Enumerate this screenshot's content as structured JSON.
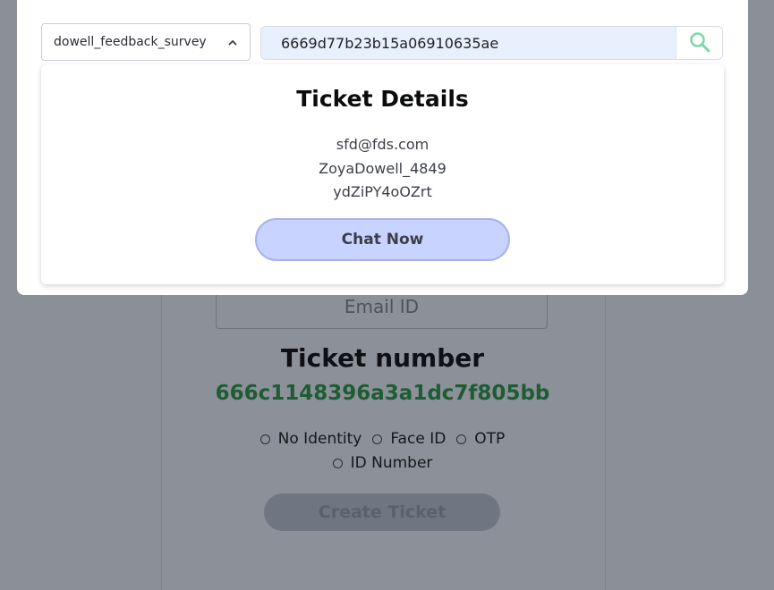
{
  "colors": {
    "overlay": "#8b8f97",
    "ticket_number_green": "#1e5c34",
    "chat_button_bg": "#c9d3ff",
    "search_icon": "#7dd8a8"
  },
  "modal": {
    "survey_select": {
      "value": "dowell_feedback_survey",
      "icon": "chevron-up-icon"
    },
    "search": {
      "value": "6669d77b23b15a06910635ae",
      "icon": "search-icon"
    },
    "details": {
      "title": "Ticket Details",
      "email": "sfd@fds.com",
      "username": "ZoyaDowell_4849",
      "code": "ydZiPY4oOZrt",
      "chat_button": "Chat Now"
    }
  },
  "form": {
    "email_placeholder": "Email ID",
    "ticket_title": "Ticket number",
    "ticket_number": "666c1148396a3a1dc7f805bb",
    "identity_options": [
      "No Identity",
      "Face ID",
      "OTP",
      "ID Number"
    ],
    "create_button": "Create Ticket"
  }
}
